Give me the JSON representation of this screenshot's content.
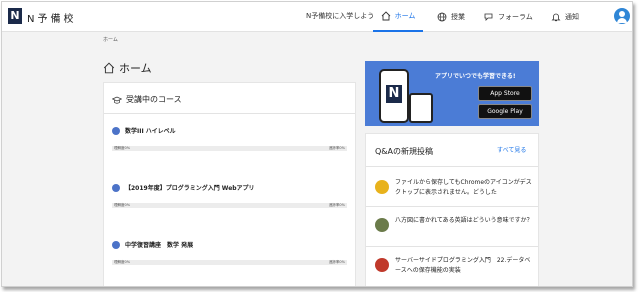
{
  "header": {
    "logo_letter": "N",
    "logo_text": "N予備校",
    "join_link": "N予備校に入学しよう",
    "nav": [
      {
        "label": "ホーム",
        "icon": "home-icon",
        "active": true
      },
      {
        "label": "授業",
        "icon": "globe-icon",
        "active": false
      },
      {
        "label": "フォーラム",
        "icon": "chat-icon",
        "active": false
      },
      {
        "label": "通知",
        "icon": "bell-icon",
        "active": false
      }
    ],
    "avatar": "user-avatar"
  },
  "breadcrumb": "ホーム",
  "page_title": "ホーム",
  "courses": {
    "heading": "受講中のコース",
    "items": [
      {
        "title": "数学III ハイレベル",
        "understanding": "理解度0%",
        "progress": "進捗率0%"
      },
      {
        "title": "【2019年度】プログラミング入門 Webアプリ",
        "understanding": "理解度0%",
        "progress": "進捗率0%"
      },
      {
        "title": "中学復習講座　数学 発展",
        "understanding": "理解度0%",
        "progress": "進捗率0%"
      }
    ]
  },
  "promo": {
    "text": "アプリでいつでも学習できる!",
    "app_store": "App Store",
    "google_play": "Google Play"
  },
  "qa": {
    "title": "Q&Aの新規投稿",
    "see_all": "すべて見る",
    "items": [
      {
        "text": "ファイルから保存してもChromeのアイコンがデスクトップに表示されません。どうした",
        "avatar_color": "#e8b21c"
      },
      {
        "text": "八方図に書かれてある英語はどういう意味ですか？",
        "avatar_color": "#6b7b4a"
      },
      {
        "text": "サーバーサイドプログラミング入門　22.データベースへの保存機能の実装",
        "avatar_color": "#c0392b"
      }
    ]
  },
  "colors": {
    "accent": "#1a73e8",
    "brand": "#1b2a4a",
    "promo_bg": "#4b7cd6"
  }
}
